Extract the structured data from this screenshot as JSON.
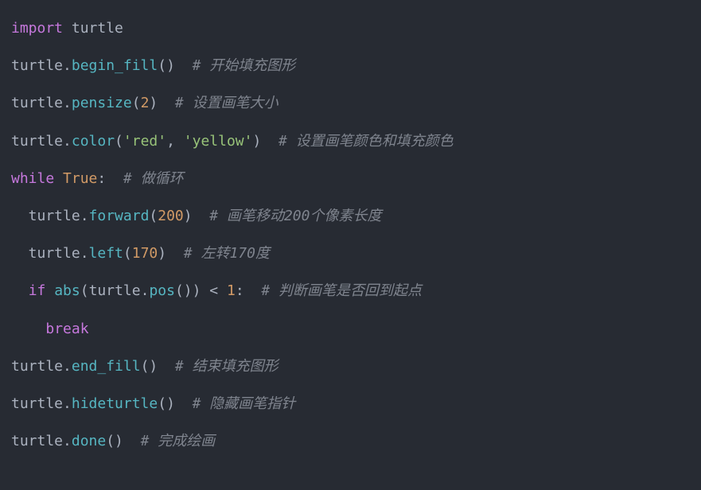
{
  "code": {
    "lines": [
      {
        "tokens": [
          {
            "cls": "kw",
            "text": "import"
          },
          {
            "cls": "plain",
            "text": " turtle"
          }
        ]
      },
      {
        "tokens": [
          {
            "cls": "plain",
            "text": "turtle."
          },
          {
            "cls": "fn",
            "text": "begin_fill"
          },
          {
            "cls": "plain",
            "text": "()  "
          },
          {
            "cls": "cmt",
            "text": "# 开始填充图形"
          }
        ]
      },
      {
        "tokens": [
          {
            "cls": "plain",
            "text": "turtle."
          },
          {
            "cls": "fn",
            "text": "pensize"
          },
          {
            "cls": "plain",
            "text": "("
          },
          {
            "cls": "num",
            "text": "2"
          },
          {
            "cls": "plain",
            "text": ")  "
          },
          {
            "cls": "cmt",
            "text": "# 设置画笔大小"
          }
        ]
      },
      {
        "tokens": [
          {
            "cls": "plain",
            "text": "turtle."
          },
          {
            "cls": "fn",
            "text": "color"
          },
          {
            "cls": "plain",
            "text": "("
          },
          {
            "cls": "str",
            "text": "'red'"
          },
          {
            "cls": "plain",
            "text": ", "
          },
          {
            "cls": "str",
            "text": "'yellow'"
          },
          {
            "cls": "plain",
            "text": ")  "
          },
          {
            "cls": "cmt",
            "text": "# 设置画笔颜色和填充颜色"
          }
        ]
      },
      {
        "tokens": [
          {
            "cls": "kw",
            "text": "while"
          },
          {
            "cls": "plain",
            "text": " "
          },
          {
            "cls": "bool",
            "text": "True"
          },
          {
            "cls": "plain",
            "text": ":  "
          },
          {
            "cls": "cmt",
            "text": "# 做循环"
          }
        ]
      },
      {
        "tokens": [
          {
            "cls": "plain",
            "text": "  turtle."
          },
          {
            "cls": "fn",
            "text": "forward"
          },
          {
            "cls": "plain",
            "text": "("
          },
          {
            "cls": "num",
            "text": "200"
          },
          {
            "cls": "plain",
            "text": ")  "
          },
          {
            "cls": "cmt",
            "text": "# 画笔移动200个像素长度"
          }
        ]
      },
      {
        "tokens": [
          {
            "cls": "plain",
            "text": "  turtle."
          },
          {
            "cls": "fn",
            "text": "left"
          },
          {
            "cls": "plain",
            "text": "("
          },
          {
            "cls": "num",
            "text": "170"
          },
          {
            "cls": "plain",
            "text": ")  "
          },
          {
            "cls": "cmt",
            "text": "# 左转170度"
          }
        ]
      },
      {
        "tokens": [
          {
            "cls": "plain",
            "text": "  "
          },
          {
            "cls": "kw",
            "text": "if"
          },
          {
            "cls": "plain",
            "text": " "
          },
          {
            "cls": "builtin",
            "text": "abs"
          },
          {
            "cls": "plain",
            "text": "(turtle."
          },
          {
            "cls": "fn",
            "text": "pos"
          },
          {
            "cls": "plain",
            "text": "()) < "
          },
          {
            "cls": "num",
            "text": "1"
          },
          {
            "cls": "plain",
            "text": ":  "
          },
          {
            "cls": "cmt",
            "text": "# 判断画笔是否回到起点"
          }
        ]
      },
      {
        "tokens": [
          {
            "cls": "plain",
            "text": "    "
          },
          {
            "cls": "kw",
            "text": "break"
          }
        ]
      },
      {
        "tokens": [
          {
            "cls": "plain",
            "text": "turtle."
          },
          {
            "cls": "fn",
            "text": "end_fill"
          },
          {
            "cls": "plain",
            "text": "()  "
          },
          {
            "cls": "cmt",
            "text": "# 结束填充图形"
          }
        ]
      },
      {
        "tokens": [
          {
            "cls": "plain",
            "text": "turtle."
          },
          {
            "cls": "fn",
            "text": "hideturtle"
          },
          {
            "cls": "plain",
            "text": "()  "
          },
          {
            "cls": "cmt",
            "text": "# 隐藏画笔指针"
          }
        ]
      },
      {
        "tokens": [
          {
            "cls": "plain",
            "text": "turtle."
          },
          {
            "cls": "fn",
            "text": "done"
          },
          {
            "cls": "plain",
            "text": "()  "
          },
          {
            "cls": "cmt",
            "text": "# 完成绘画"
          }
        ]
      }
    ]
  }
}
